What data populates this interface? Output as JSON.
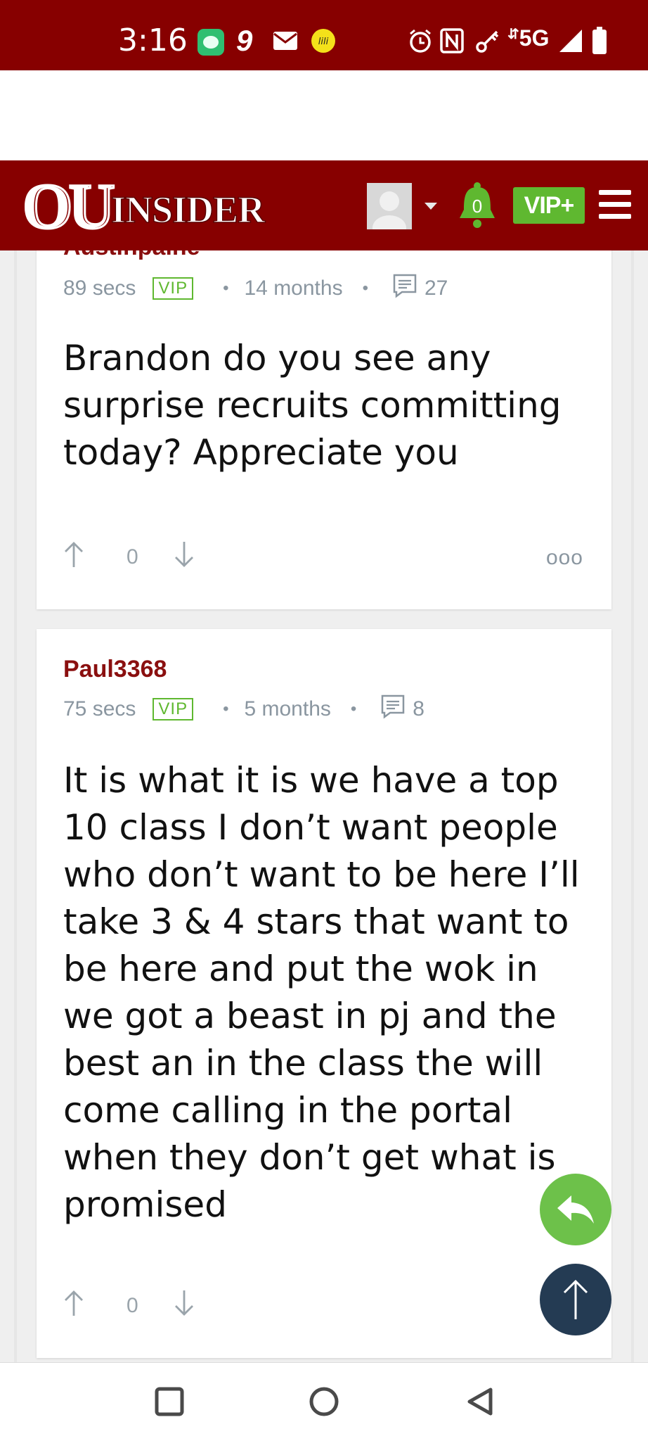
{
  "status_bar": {
    "time": "3:16",
    "left_icons": [
      "messages-app-icon",
      "nine-icon",
      "mail-icon",
      "lili-icon"
    ],
    "right_icons": [
      "alarm-icon",
      "nfc-icon",
      "key-icon",
      "network-icon",
      "signal-icon",
      "battery-icon"
    ],
    "network_label": "5G",
    "color": "#870000"
  },
  "header": {
    "logo_text_ou": "OU",
    "logo_text_insider": "INSIDER",
    "notification_count": "0",
    "vip_label": "VIP+",
    "color": "#870000",
    "accent": "#5fb830"
  },
  "posts": [
    {
      "username": "Austinpaine",
      "duration": "89 secs",
      "badge": "VIP",
      "age": "14 months",
      "reply_count": "27",
      "body": "Brandon do you see any surprise recruits committing today? Appreciate you",
      "votes": "0",
      "more_label": "ooo"
    },
    {
      "username": "Paul3368",
      "duration": "75 secs",
      "badge": "VIP",
      "age": "5 months",
      "reply_count": "8",
      "body": "It is what it is we have a top 10 class I don’t want people who don’t want to be here I’ll take 3 & 4 stars that want to be here and put the wok in we got a beast in pj and the best an in the class the will come calling in the portal when they don’t get what is promised",
      "votes": "0"
    }
  ],
  "fabs": {
    "reply_icon": "reply-icon",
    "top_icon": "arrow-up-icon",
    "reply_color": "#6dc14a",
    "top_color": "#243b53"
  },
  "nav_bar": {
    "buttons": [
      "recents-square-icon",
      "home-circle-icon",
      "back-triangle-icon"
    ]
  }
}
